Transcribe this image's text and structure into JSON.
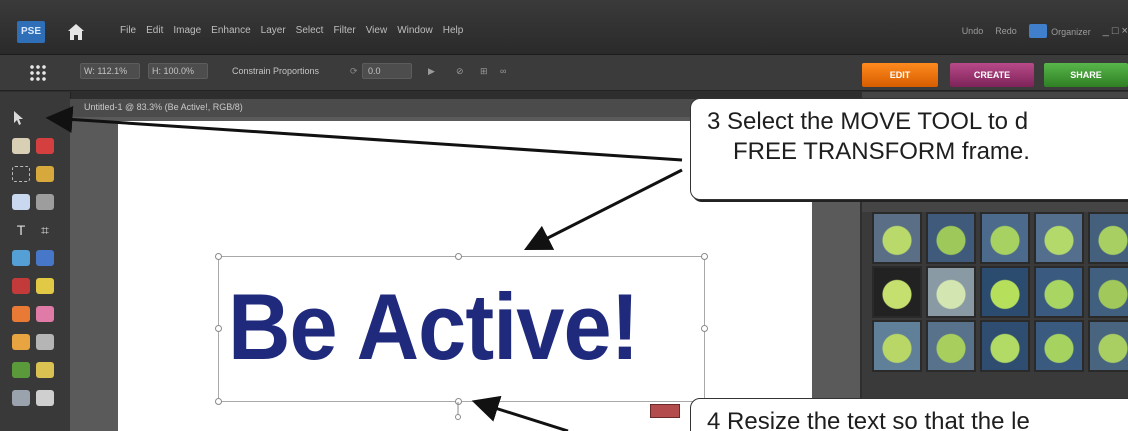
{
  "app": {
    "logo_text": "PSE",
    "menu": [
      "File",
      "Edit",
      "Image",
      "Enhance",
      "Layer",
      "Select",
      "Filter",
      "View",
      "Window",
      "Help"
    ],
    "undo_label": "Undo",
    "redo_label": "Redo",
    "organizer_label": "Organizer",
    "window_controls": "_ □ ×"
  },
  "options_bar": {
    "width_label": "W: 112.1%",
    "height_label": "H: 100.0%",
    "constrain_label": "Constrain Proportions",
    "rotate_value": "0.0"
  },
  "mode_tabs": {
    "edit": "EDIT",
    "create": "CREATE",
    "share": "SHARE"
  },
  "document": {
    "title": "Untitled-1 @ 83.3% (Be Active!, RGB/8)",
    "canvas_text": "Be Active!"
  },
  "callouts": {
    "step3_line1": "3  Select the MOVE TOOL to d",
    "step3_line2": "FREE TRANSFORM frame.",
    "step4": "4  Resize the text so that the le"
  },
  "colors": {
    "text_blue": "#1f2a7c",
    "edit_tab": "#ff8a1e",
    "create_tab": "#b84a89",
    "share_tab": "#58b64a"
  }
}
